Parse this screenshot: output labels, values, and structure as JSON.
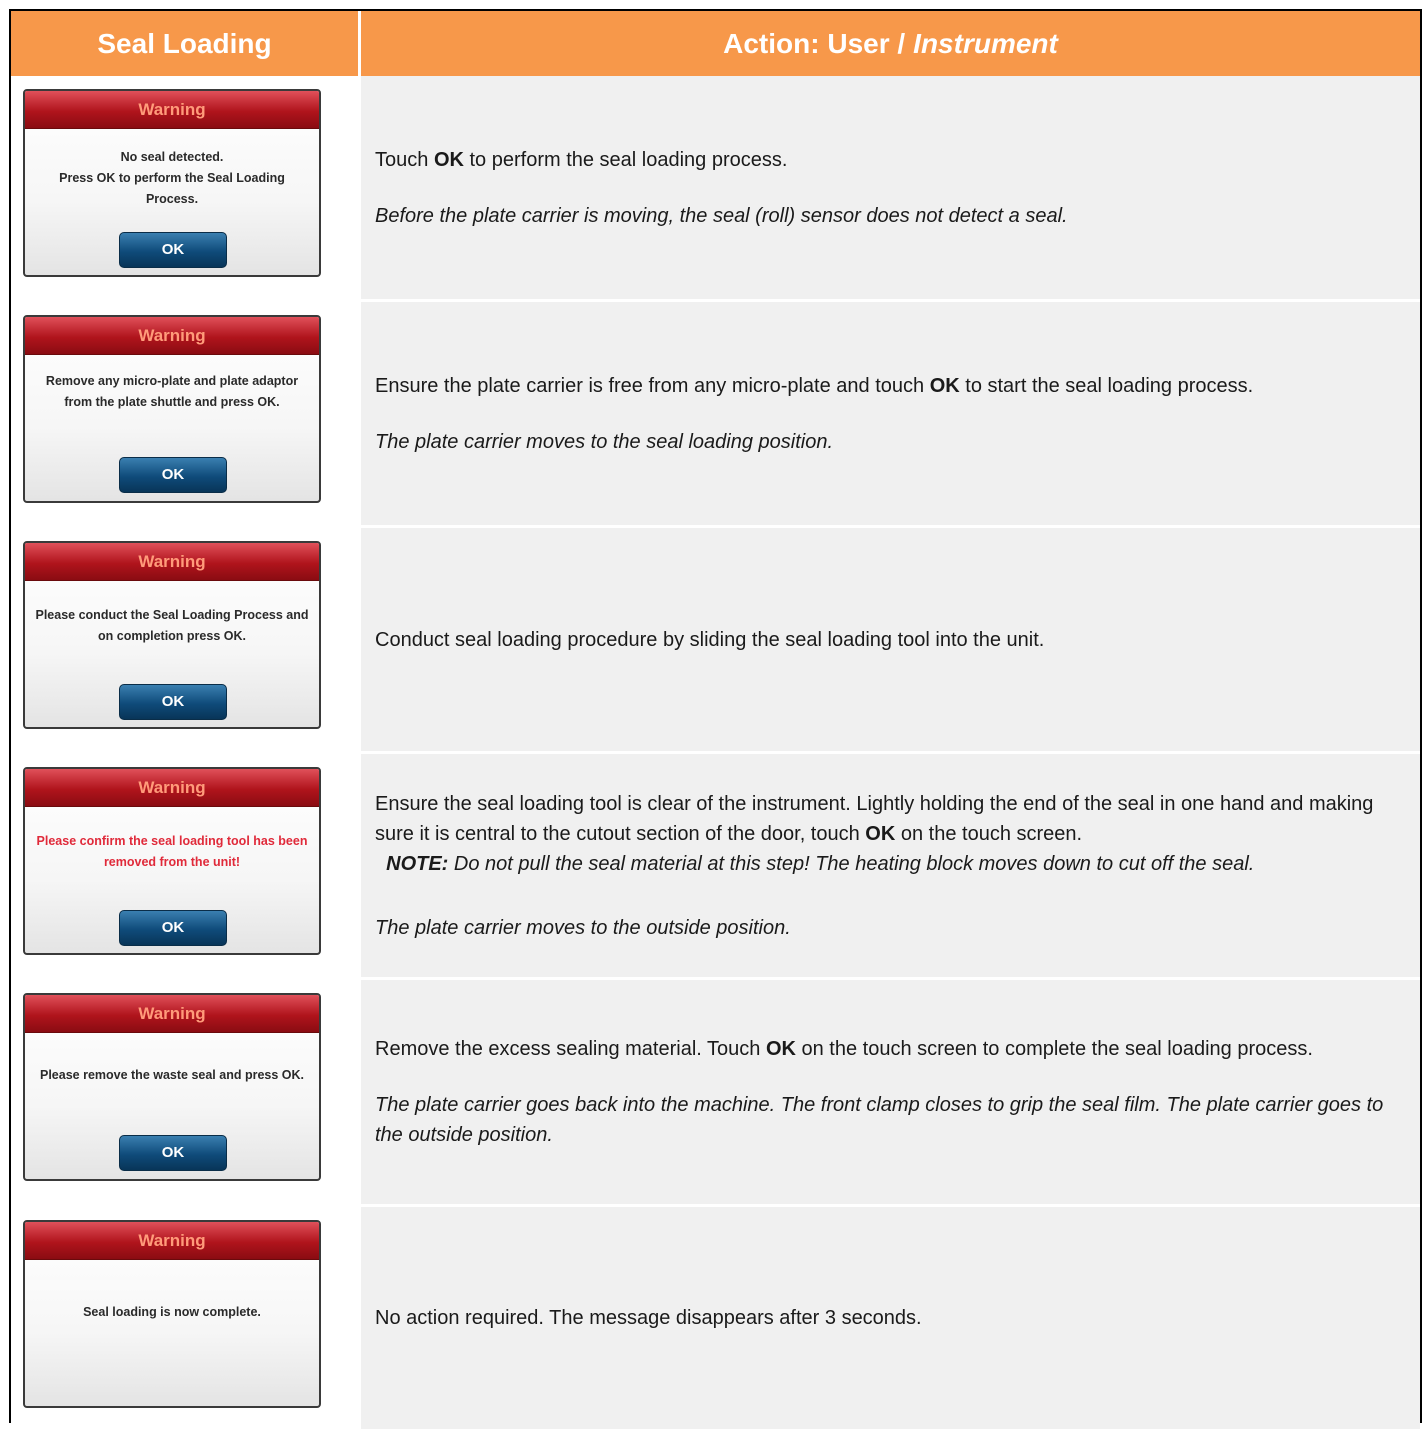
{
  "header": {
    "col1": "Seal Loading",
    "col2_plain": "Action: User /",
    "col2_italic": "Instrument"
  },
  "rows": [
    {
      "dialog": {
        "title": "Warning",
        "message": "No seal detected.\nPress OK to perform the Seal Loading Process.",
        "button": "OK",
        "message_color": "dark"
      },
      "action": {
        "pre": "Touch ",
        "bold": "OK",
        "post": " to perform the seal loading process.",
        "note": "Before the plate carrier is moving, the seal (roll) sensor does not detect a seal."
      }
    },
    {
      "dialog": {
        "title": "Warning",
        "message": "Remove any micro-plate and plate adaptor from the plate shuttle and press OK.",
        "button": "OK",
        "message_color": "dark"
      },
      "action": {
        "pre": "Ensure the plate carrier is free from any micro-plate and touch ",
        "bold": "OK",
        "post": " to start the seal loading process.",
        "note": "The plate carrier moves to the seal loading position."
      }
    },
    {
      "dialog": {
        "title": "Warning",
        "message": "Please conduct the Seal Loading Process and on completion press OK.",
        "button": "OK",
        "message_color": "dark"
      },
      "action": {
        "text": "Conduct seal loading procedure by sliding the seal loading tool into the unit."
      }
    },
    {
      "dialog": {
        "title": "Warning",
        "message": "Please confirm the seal loading tool has been removed from the unit!",
        "button": "OK",
        "message_color": "red"
      },
      "action": {
        "pre": "Ensure the seal loading tool is clear of the instrument. Lightly holding the end of the seal in one hand and making sure it is central to the cutout section of the door, touch ",
        "bold": "OK",
        "post": " on the touch screen.",
        "note_label": "NOTE:",
        "note_text": " Do not pull the seal material at this step! The heating block moves down to cut off the seal.",
        "note": "The plate carrier moves to the outside position."
      }
    },
    {
      "dialog": {
        "title": "Warning",
        "message": "Please remove the waste seal and press OK.",
        "button": "OK",
        "message_color": "dark"
      },
      "action": {
        "pre": "Remove the excess sealing material. Touch ",
        "bold": "OK",
        "post": " on the touch screen to complete the seal loading process.",
        "note": "The plate carrier goes back into the machine. The front clamp closes to grip the seal film. The plate carrier goes to the outside position."
      }
    },
    {
      "dialog": {
        "title": "Warning",
        "message": "Seal loading is now complete.",
        "button": "",
        "message_color": "dark"
      },
      "action": {
        "text": "No action required. The message disappears after 3 seconds."
      }
    }
  ]
}
